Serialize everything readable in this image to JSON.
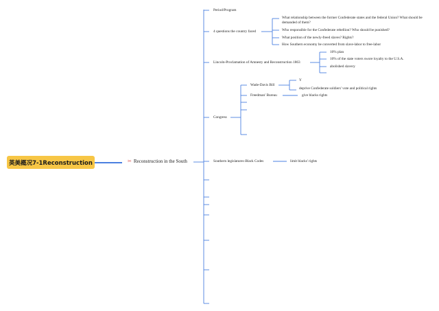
{
  "root": {
    "title": "英美概况7-1Reconstruction"
  },
  "main": {
    "title": "Reconstruction in the South",
    "icon": "tools-icon"
  },
  "branches": {
    "period": "Period/Program",
    "questions": {
      "label": "4 questions the country faced",
      "items": [
        "What relationship between the former Confederate states and the federal Union? What should be demanded of them?",
        "Who responsible for the Confederate rebellion? Who should be punished?",
        "What position of the newly-freed slaves? Rights?",
        "How Southern economy be converted from slave-labor to free-labor"
      ]
    },
    "lincoln": {
      "label": "Lincoln-Proclamation of Amnesty and Reconstruction 1863",
      "items": [
        "10% plan",
        "10% of the state voters swore loyalty to the U.S.A.",
        "abolished slavery"
      ]
    },
    "congress": {
      "label": "Congress",
      "wade_davis": {
        "label": "Wade-Davis Bill",
        "items": [
          "Y",
          "deprive Confederate soldiers' vote and political rights"
        ]
      },
      "freedmen": {
        "label": "Freedman' Bureau",
        "items": [
          "give blacks rights"
        ]
      }
    },
    "southern": {
      "label": "Southern legislatures-Black Codes",
      "items": [
        "limit blacks' rights"
      ]
    }
  },
  "colors": {
    "root_fill": "#f7c645",
    "line": "#4a7fe0",
    "icon": "#d9534f"
  }
}
